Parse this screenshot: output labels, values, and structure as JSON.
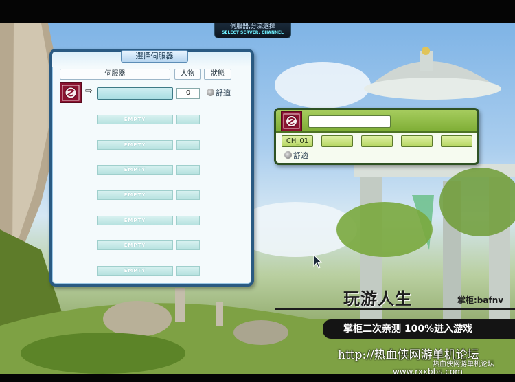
{
  "header": {
    "title_cn": "伺服器,分流選擇",
    "title_en": "SELECT SERVER, CHANNEL"
  },
  "server_window": {
    "title": "選擇伺服器",
    "columns": [
      "伺服器",
      "人物",
      "狀態"
    ],
    "selected_server": {
      "name": "",
      "count": "0",
      "status": "舒適"
    },
    "empty_slots": [
      "EMPTY",
      "EMPTY",
      "EMPTY",
      "EMPTY",
      "EMPTY",
      "EMPTY",
      "EMPTY"
    ]
  },
  "channel_window": {
    "server_name": "",
    "channels": [
      "CH_01",
      "",
      "",
      "",
      ""
    ],
    "status": "舒適"
  },
  "watermark": {
    "slogan": "玩游人生",
    "owner": "掌柜:bafnv",
    "banner": "掌柜二次亲测  100%进入游戏",
    "url": "http://热血侠网游单机论坛",
    "forum": "热血侠网游单机论坛",
    "site": "www.rxxbbs.com"
  },
  "colors": {
    "server_frame": "#2a5a82",
    "channel_frame": "#2f5224",
    "channel_header": "#8cb945"
  }
}
